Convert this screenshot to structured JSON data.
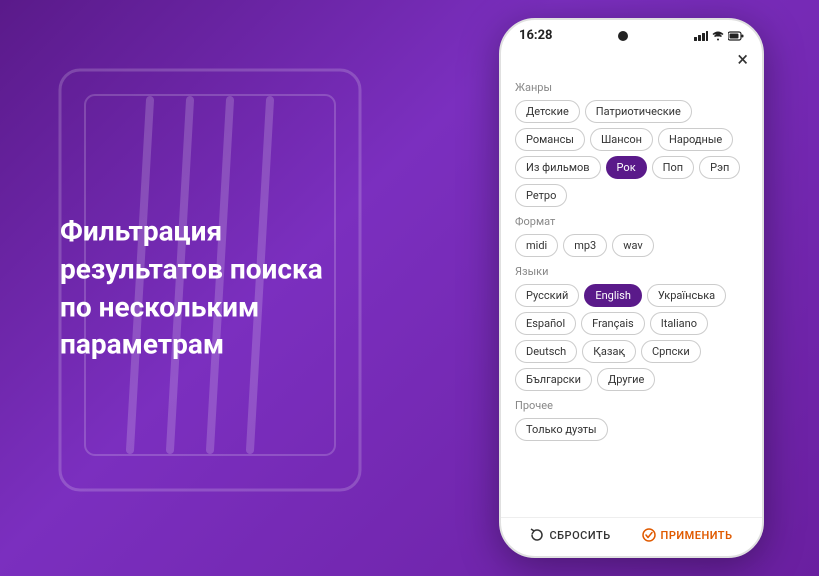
{
  "background": {
    "gradient_start": "#5a1a8a",
    "gradient_end": "#6a1fa0"
  },
  "left_text": {
    "line1": "Фильтрация",
    "line2": "результатов поиска",
    "line3": "по нескольким",
    "line4": "параметрам"
  },
  "phone": {
    "status_bar": {
      "time": "16:28",
      "signal": "●●●",
      "wifi": "wifi",
      "battery": "battery"
    },
    "close_label": "×",
    "sections": [
      {
        "id": "genres",
        "label": "Жанры",
        "tags": [
          {
            "label": "Детские",
            "active": false
          },
          {
            "label": "Патриотические",
            "active": false
          },
          {
            "label": "Романсы",
            "active": false
          },
          {
            "label": "Шансон",
            "active": false
          },
          {
            "label": "Народные",
            "active": false
          },
          {
            "label": "Из фильмов",
            "active": false
          },
          {
            "label": "Рок",
            "active": true
          },
          {
            "label": "Поп",
            "active": false
          },
          {
            "label": "Рэп",
            "active": false
          },
          {
            "label": "Ретро",
            "active": false
          }
        ]
      },
      {
        "id": "format",
        "label": "Формат",
        "tags": [
          {
            "label": "midi",
            "active": false
          },
          {
            "label": "mp3",
            "active": false
          },
          {
            "label": "wav",
            "active": false
          }
        ]
      },
      {
        "id": "languages",
        "label": "Языки",
        "tags": [
          {
            "label": "Русский",
            "active": false
          },
          {
            "label": "English",
            "active": true
          },
          {
            "label": "Українська",
            "active": false
          },
          {
            "label": "Español",
            "active": false
          },
          {
            "label": "Français",
            "active": false
          },
          {
            "label": "Italiano",
            "active": false
          },
          {
            "label": "Deutsch",
            "active": false
          },
          {
            "label": "Қазақ",
            "active": false
          },
          {
            "label": "Српски",
            "active": false
          },
          {
            "label": "Български",
            "active": false
          },
          {
            "label": "Другие",
            "active": false
          }
        ]
      },
      {
        "id": "other",
        "label": "Прочее",
        "tags": [
          {
            "label": "Только дуэты",
            "active": false
          }
        ]
      }
    ],
    "bottom": {
      "reset_label": "СБРОСИТЬ",
      "apply_label": "ПРИМЕНИТЬ"
    }
  }
}
